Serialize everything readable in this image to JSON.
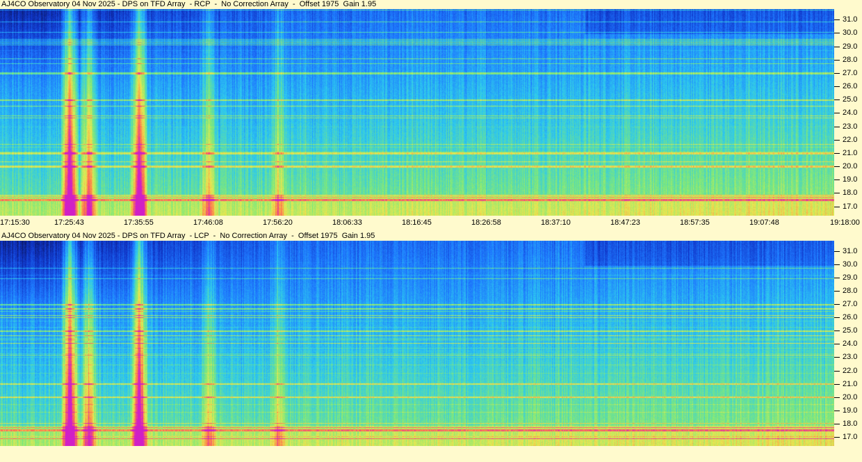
{
  "chart_data": [
    {
      "type": "heatmap",
      "title": "AJ4CO Observatory 04 Nov 2025 - DPS on TFD Array  - RCP  -  No Correction Array  -  Offset 1975  Gain 1.95",
      "polarization": "RCP",
      "y_tick_labels": [
        "31.0",
        "30.0",
        "29.0",
        "28.0",
        "27.0",
        "26.0",
        "25.0",
        "24.0",
        "23.0",
        "22.0",
        "21.0",
        "20.0",
        "19.0",
        "18.0",
        "17.0"
      ],
      "y_values_mhz": [
        31,
        30,
        29,
        28,
        27,
        26,
        25,
        24,
        23,
        22,
        21,
        20,
        19,
        18,
        17
      ],
      "x_tick_labels": [
        "17:15:30",
        "17:25:43",
        "17:35:55",
        "17:46:08",
        "17:56:20",
        "18:06:33",
        "18:16:45",
        "18:26:58",
        "18:37:10",
        "18:47:23",
        "18:57:35",
        "19:07:48",
        "19:18:00"
      ],
      "colormap": [
        "#0a1250",
        "#1035c8",
        "#1e78ff",
        "#2cc8f0",
        "#7ce87c",
        "#e8e850",
        "#ff7a4a",
        "#d01ec8"
      ],
      "bursts": [
        {
          "time": "17:25:43",
          "intensity": 0.9
        },
        {
          "time": "17:28:30",
          "intensity": 0.55
        },
        {
          "time": "17:35:55",
          "intensity": 0.85
        },
        {
          "time": "17:46:08",
          "intensity": 0.35
        },
        {
          "time": "17:56:20",
          "intensity": 0.3
        }
      ],
      "rfi_lines_mhz": [
        27.0,
        25.0,
        21.0,
        20.0,
        17.5
      ]
    },
    {
      "type": "heatmap",
      "title": "AJ4CO Observatory 04 Nov 2025 - DPS on TFD Array  - LCP  -  No Correction Array  -  Offset 1975  Gain 1.95",
      "polarization": "LCP",
      "y_tick_labels": [
        "31.0",
        "30.0",
        "29.0",
        "28.0",
        "27.0",
        "26.0",
        "25.0",
        "24.0",
        "23.0",
        "22.0",
        "21.0",
        "20.0",
        "19.0",
        "18.0",
        "17.0"
      ],
      "y_values_mhz": [
        31,
        30,
        29,
        28,
        27,
        26,
        25,
        24,
        23,
        22,
        21,
        20,
        19,
        18,
        17
      ],
      "x_tick_labels": [],
      "colormap": [
        "#0a1250",
        "#1035c8",
        "#1e78ff",
        "#2cc8f0",
        "#7ce87c",
        "#e8e850",
        "#ff7a4a",
        "#d01ec8"
      ],
      "bursts": [
        {
          "time": "17:25:43",
          "intensity": 0.9
        },
        {
          "time": "17:28:30",
          "intensity": 0.55
        },
        {
          "time": "17:35:55",
          "intensity": 0.85
        },
        {
          "time": "17:46:08",
          "intensity": 0.35
        },
        {
          "time": "17:56:20",
          "intensity": 0.3
        }
      ],
      "rfi_lines_mhz": [
        27.0,
        25.0,
        21.0,
        20.0,
        17.5
      ]
    }
  ]
}
